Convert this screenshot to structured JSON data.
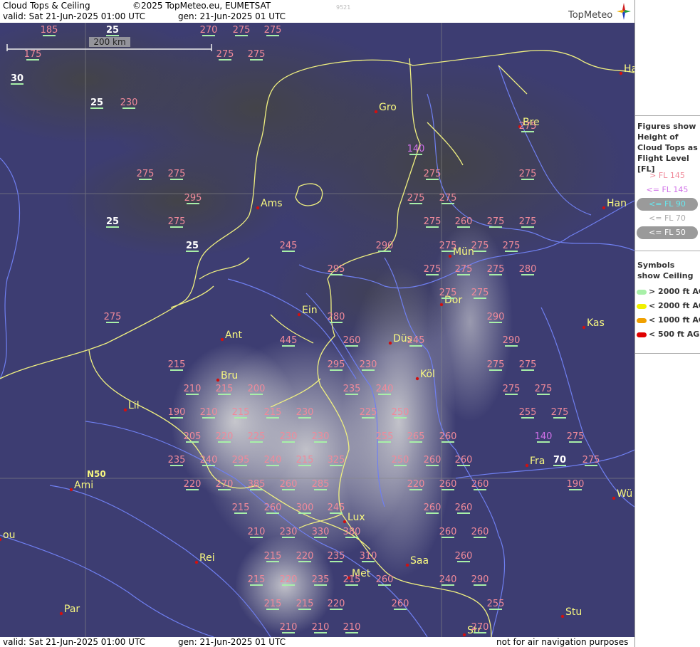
{
  "header": {
    "title": "Cloud Tops & Ceiling",
    "copyright": "©2025 TopMeteo.eu, EUMETSAT",
    "valid": "valid:  Sat  21-Jun-2025  01:00 UTC",
    "generated": "gen: 21-Jun-2025 01 UTC",
    "code": "9521",
    "brand": "TopMeteo"
  },
  "footer": {
    "valid": "valid:  Sat  21-Jun-2025  01:00 UTC",
    "generated": "gen: 21-Jun-2025 01 UTC",
    "disclaimer": "not for air navigation purposes"
  },
  "scale_label": "200 km",
  "lat_label": "N50",
  "legend": {
    "title": "Figures show Height of Cloud Tops as Flight Level  [FL]",
    "items": [
      {
        "label": "> FL 145",
        "color": "#f08a9a",
        "pill": false
      },
      {
        "label": "<= FL 145",
        "color": "#d070e8",
        "pill": false
      },
      {
        "label": "<= FL 90",
        "color": "#66e8f0",
        "pill": true
      },
      {
        "label": "<= FL 70",
        "color": "#aaaaaa",
        "pill": false
      },
      {
        "label": "<= FL 50",
        "color": "#ffffff",
        "pill": true
      }
    ],
    "symbols_title": "Symbols show Ceiling",
    "symbols": [
      {
        "label": "> 2000 ft AGL",
        "color": "#a8f0a8"
      },
      {
        "label": "< 2000 ft AGL",
        "color": "#f0f000"
      },
      {
        "label": "< 1000 ft AGL",
        "color": "#f0a000"
      },
      {
        "label": "< 500 ft AGL",
        "color": "#e00000"
      }
    ]
  },
  "colors": {
    "high": "#f08a9a",
    "mid": "#d070e8",
    "low": "#ffffff",
    "ceil_ok": "#a8f0a8",
    "border": "#f0f080",
    "river": "#6f7ff0",
    "grid": "#888888",
    "city_dot": "#d01010"
  },
  "cities": [
    "Gro",
    "Bre",
    "Ha",
    "Ams",
    "Han",
    "Mün",
    "Dor",
    "Ein",
    "Kas",
    "Ant",
    "Düs",
    "Köl",
    "Bru",
    "Lil",
    "Fra",
    "Ami",
    "Wü",
    "Lux",
    "Rei",
    "Saa",
    "Met",
    "Par",
    "Stu",
    "Str",
    "ou"
  ],
  "figures": [
    {
      "v": "185",
      "t": "high"
    },
    {
      "v": "25",
      "t": "low"
    },
    {
      "v": "270",
      "t": "high"
    },
    {
      "v": "275",
      "t": "high"
    },
    {
      "v": "275",
      "t": "high"
    },
    {
      "v": "175",
      "t": "high"
    },
    {
      "v": "275",
      "t": "high"
    },
    {
      "v": "275",
      "t": "high"
    },
    {
      "v": "30",
      "t": "low"
    },
    {
      "v": "25",
      "t": "low"
    },
    {
      "v": "230",
      "t": "high"
    },
    {
      "v": "275",
      "t": "high"
    },
    {
      "v": "140",
      "t": "mid"
    },
    {
      "v": "275",
      "t": "high"
    },
    {
      "v": "275",
      "t": "high"
    },
    {
      "v": "275",
      "t": "high"
    },
    {
      "v": "275",
      "t": "high"
    },
    {
      "v": "295",
      "t": "high"
    },
    {
      "v": "275",
      "t": "high"
    },
    {
      "v": "275",
      "t": "high"
    },
    {
      "v": "25",
      "t": "low"
    },
    {
      "v": "275",
      "t": "high"
    },
    {
      "v": "275",
      "t": "high"
    },
    {
      "v": "260",
      "t": "high"
    },
    {
      "v": "275",
      "t": "high"
    },
    {
      "v": "275",
      "t": "high"
    },
    {
      "v": "25",
      "t": "low"
    },
    {
      "v": "245",
      "t": "high"
    },
    {
      "v": "290",
      "t": "high"
    },
    {
      "v": "275",
      "t": "high"
    },
    {
      "v": "275",
      "t": "high"
    },
    {
      "v": "275",
      "t": "high"
    },
    {
      "v": "295",
      "t": "high"
    },
    {
      "v": "275",
      "t": "high"
    },
    {
      "v": "275",
      "t": "high"
    },
    {
      "v": "275",
      "t": "high"
    },
    {
      "v": "280",
      "t": "high"
    },
    {
      "v": "275",
      "t": "high"
    },
    {
      "v": "275",
      "t": "high"
    },
    {
      "v": "275",
      "t": "high"
    },
    {
      "v": "280",
      "t": "high"
    },
    {
      "v": "290",
      "t": "high"
    },
    {
      "v": "445",
      "t": "high"
    },
    {
      "v": "260",
      "t": "high"
    },
    {
      "v": "245",
      "t": "high"
    },
    {
      "v": "290",
      "t": "high"
    },
    {
      "v": "215",
      "t": "high"
    },
    {
      "v": "295",
      "t": "high"
    },
    {
      "v": "230",
      "t": "high"
    },
    {
      "v": "275",
      "t": "high"
    },
    {
      "v": "275",
      "t": "high"
    },
    {
      "v": "210",
      "t": "high"
    },
    {
      "v": "215",
      "t": "high"
    },
    {
      "v": "200",
      "t": "high"
    },
    {
      "v": "235",
      "t": "high"
    },
    {
      "v": "240",
      "t": "high"
    },
    {
      "v": "275",
      "t": "high"
    },
    {
      "v": "275",
      "t": "high"
    },
    {
      "v": "190",
      "t": "high"
    },
    {
      "v": "210",
      "t": "high"
    },
    {
      "v": "215",
      "t": "high"
    },
    {
      "v": "215",
      "t": "high"
    },
    {
      "v": "230",
      "t": "high"
    },
    {
      "v": "225",
      "t": "high"
    },
    {
      "v": "250",
      "t": "high"
    },
    {
      "v": "255",
      "t": "high"
    },
    {
      "v": "275",
      "t": "high"
    },
    {
      "v": "205",
      "t": "high"
    },
    {
      "v": "220",
      "t": "high"
    },
    {
      "v": "225",
      "t": "high"
    },
    {
      "v": "230",
      "t": "high"
    },
    {
      "v": "230",
      "t": "high"
    },
    {
      "v": "255",
      "t": "high"
    },
    {
      "v": "265",
      "t": "high"
    },
    {
      "v": "260",
      "t": "high"
    },
    {
      "v": "140",
      "t": "mid"
    },
    {
      "v": "275",
      "t": "high"
    },
    {
      "v": "235",
      "t": "high"
    },
    {
      "v": "240",
      "t": "high"
    },
    {
      "v": "295",
      "t": "high"
    },
    {
      "v": "240",
      "t": "high"
    },
    {
      "v": "215",
      "t": "high"
    },
    {
      "v": "325",
      "t": "high"
    },
    {
      "v": "250",
      "t": "high"
    },
    {
      "v": "260",
      "t": "high"
    },
    {
      "v": "260",
      "t": "high"
    },
    {
      "v": "70",
      "t": "low"
    },
    {
      "v": "275",
      "t": "high"
    },
    {
      "v": "220",
      "t": "high"
    },
    {
      "v": "270",
      "t": "high"
    },
    {
      "v": "385",
      "t": "high"
    },
    {
      "v": "260",
      "t": "high"
    },
    {
      "v": "285",
      "t": "high"
    },
    {
      "v": "220",
      "t": "high"
    },
    {
      "v": "260",
      "t": "high"
    },
    {
      "v": "260",
      "t": "high"
    },
    {
      "v": "190",
      "t": "high"
    },
    {
      "v": "215",
      "t": "high"
    },
    {
      "v": "260",
      "t": "high"
    },
    {
      "v": "300",
      "t": "high"
    },
    {
      "v": "245",
      "t": "high"
    },
    {
      "v": "260",
      "t": "high"
    },
    {
      "v": "260",
      "t": "high"
    },
    {
      "v": "210",
      "t": "high"
    },
    {
      "v": "230",
      "t": "high"
    },
    {
      "v": "330",
      "t": "high"
    },
    {
      "v": "380",
      "t": "high"
    },
    {
      "v": "260",
      "t": "high"
    },
    {
      "v": "260",
      "t": "high"
    },
    {
      "v": "215",
      "t": "high"
    },
    {
      "v": "220",
      "t": "high"
    },
    {
      "v": "235",
      "t": "high"
    },
    {
      "v": "310",
      "t": "high"
    },
    {
      "v": "260",
      "t": "high"
    },
    {
      "v": "215",
      "t": "high"
    },
    {
      "v": "220",
      "t": "high"
    },
    {
      "v": "235",
      "t": "high"
    },
    {
      "v": "215",
      "t": "high"
    },
    {
      "v": "260",
      "t": "high"
    },
    {
      "v": "240",
      "t": "high"
    },
    {
      "v": "290",
      "t": "high"
    },
    {
      "v": "215",
      "t": "high"
    },
    {
      "v": "215",
      "t": "high"
    },
    {
      "v": "220",
      "t": "high"
    },
    {
      "v": "260",
      "t": "high"
    },
    {
      "v": "255",
      "t": "high"
    },
    {
      "v": "210",
      "t": "high"
    },
    {
      "v": "210",
      "t": "high"
    },
    {
      "v": "210",
      "t": "high"
    },
    {
      "v": "270",
      "t": "high"
    }
  ]
}
